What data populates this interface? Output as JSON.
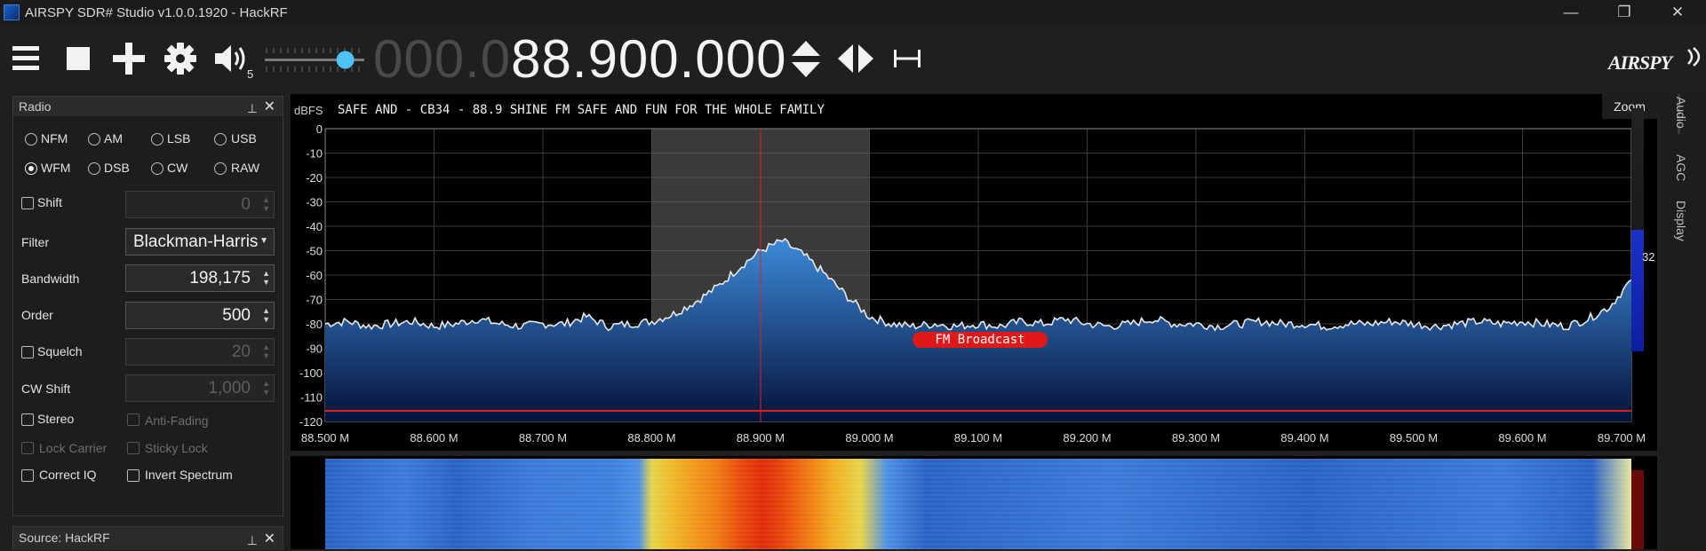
{
  "window": {
    "title": "AIRSPY SDR# Studio v1.0.0.1920 - HackRF",
    "minimize": "—",
    "maximize": "❐",
    "close": "✕"
  },
  "toolbar": {
    "volume_level": "5",
    "volume_slider_fraction": 0.82,
    "frequency_dim": "000.0",
    "frequency_lit": "88.900.000",
    "brand": "AIRSPY"
  },
  "radio_panel": {
    "title": "Radio",
    "modes": [
      {
        "label": "NFM",
        "selected": false
      },
      {
        "label": "AM",
        "selected": false
      },
      {
        "label": "LSB",
        "selected": false
      },
      {
        "label": "USB",
        "selected": false
      },
      {
        "label": "WFM",
        "selected": true
      },
      {
        "label": "DSB",
        "selected": false
      },
      {
        "label": "CW",
        "selected": false
      },
      {
        "label": "RAW",
        "selected": false
      }
    ],
    "shift": {
      "label": "Shift",
      "value": "0"
    },
    "filter": {
      "label": "Filter",
      "value": "Blackman-Harris"
    },
    "bandwidth": {
      "label": "Bandwidth",
      "value": "198,175"
    },
    "order": {
      "label": "Order",
      "value": "500"
    },
    "squelch": {
      "label": "Squelch",
      "value": "20"
    },
    "cw_shift": {
      "label": "CW Shift",
      "value": "1,000"
    },
    "stereo": "Stereo",
    "anti_fading": "Anti-Fading",
    "lock_carrier": "Lock Carrier",
    "sticky_lock": "Sticky Lock",
    "correct_iq": "Correct IQ",
    "invert_spectrum": "Invert Spectrum"
  },
  "source_panel": {
    "title": "Source: HackRF"
  },
  "spectrum": {
    "unit": "dBFS",
    "station_text": "SAFE AND - CB34 - 88.9 SHINE FM SAFE AND FUN FOR THE WHOLE FAMILY",
    "zoom_label": "Zoom",
    "band_label": "FM Broadcast",
    "level_readout": "32",
    "colors": {
      "fill_top": "#3d8ad8",
      "fill_bottom": "#05123a",
      "trace": "#e8e8e8",
      "marker": "#e02020"
    }
  },
  "side_tabs": [
    "Audio",
    "AGC",
    "Display"
  ],
  "chart_data": {
    "type": "area",
    "xlabel": "",
    "ylabel": "dBFS",
    "x_ticks": [
      "88.500 M",
      "88.600 M",
      "88.700 M",
      "88.800 M",
      "88.900 M",
      "89.000 M",
      "89.100 M",
      "89.200 M",
      "89.300 M",
      "89.400 M",
      "89.500 M",
      "89.600 M",
      "89.700 M"
    ],
    "y_ticks": [
      "0",
      "-10",
      "-20",
      "-30",
      "-40",
      "-50",
      "-60",
      "-70",
      "-80",
      "-90",
      "-100",
      "-110",
      "-120"
    ],
    "xlim": [
      88.5,
      89.7
    ],
    "ylim": [
      -120,
      0
    ],
    "grid": true,
    "center_frequency": 88.9,
    "filter_band": [
      88.8,
      89.0
    ],
    "series": [
      {
        "x": [
          88.5,
          88.52,
          88.54,
          88.56,
          88.58,
          88.6,
          88.62,
          88.64,
          88.66,
          88.68,
          88.7,
          88.72,
          88.74,
          88.76,
          88.78,
          88.8,
          88.82,
          88.84,
          88.86,
          88.88,
          88.9,
          88.92,
          88.94,
          88.96,
          88.98,
          89.0,
          89.02,
          89.04,
          89.06,
          89.08,
          89.1,
          89.12,
          89.14,
          89.16,
          89.18,
          89.2,
          89.22,
          89.24,
          89.26,
          89.28,
          89.3,
          89.32,
          89.34,
          89.36,
          89.38,
          89.4,
          89.42,
          89.44,
          89.46,
          89.48,
          89.5,
          89.52,
          89.54,
          89.56,
          89.58,
          89.6,
          89.62,
          89.64,
          89.66,
          89.68,
          89.7
        ],
        "values": [
          -80,
          -79,
          -81,
          -80,
          -79,
          -81,
          -80,
          -78,
          -80,
          -81,
          -80,
          -80,
          -77,
          -81,
          -80,
          -79,
          -76,
          -71,
          -65,
          -57,
          -50,
          -46,
          -52,
          -60,
          -69,
          -77,
          -80,
          -81,
          -80,
          -81,
          -80,
          -81,
          -79,
          -80,
          -78,
          -80,
          -81,
          -80,
          -78,
          -80,
          -80,
          -81,
          -80,
          -79,
          -80,
          -80,
          -81,
          -80,
          -80,
          -79,
          -80,
          -81,
          -80,
          -79,
          -80,
          -79,
          -80,
          -81,
          -78,
          -73,
          -62
        ]
      }
    ]
  }
}
